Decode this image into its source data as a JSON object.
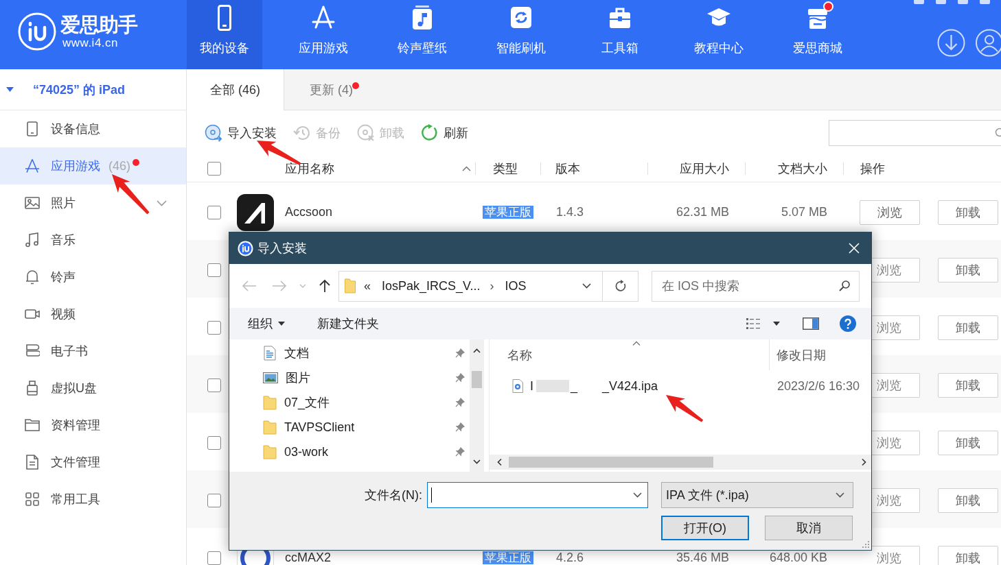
{
  "app": {
    "name": "爱思助手",
    "url": "www.i4.cn"
  },
  "top_nav": [
    {
      "label": "我的设备",
      "selected": true,
      "dot": false
    },
    {
      "label": "应用游戏",
      "selected": false,
      "dot": false
    },
    {
      "label": "铃声壁纸",
      "selected": false,
      "dot": false
    },
    {
      "label": "智能刷机",
      "selected": false,
      "dot": false
    },
    {
      "label": "工具箱",
      "selected": false,
      "dot": false
    },
    {
      "label": "教程中心",
      "selected": false,
      "dot": false
    },
    {
      "label": "爱思商城",
      "selected": false,
      "dot": true
    }
  ],
  "sidebar": {
    "device": {
      "name": "“74025” 的 iPad",
      "expanded": true
    },
    "items": [
      {
        "label": "设备信息",
        "selected": false,
        "dot": false
      },
      {
        "label": "应用游戏",
        "selected": true,
        "count": "(46)",
        "dot": true
      },
      {
        "label": "照片",
        "selected": false,
        "dot": false,
        "expanded": false
      },
      {
        "label": "音乐",
        "selected": false,
        "dot": false
      },
      {
        "label": "铃声",
        "selected": false,
        "dot": false
      },
      {
        "label": "视频",
        "selected": false,
        "dot": false
      },
      {
        "label": "电子书",
        "selected": false,
        "dot": false
      },
      {
        "label": "虚拟U盘",
        "selected": false,
        "dot": false
      },
      {
        "label": "资料管理",
        "selected": false,
        "dot": false
      },
      {
        "label": "文件管理",
        "selected": false,
        "dot": false
      },
      {
        "label": "常用工具",
        "selected": false,
        "dot": false
      }
    ]
  },
  "tabs": [
    {
      "label": "全部 (46)",
      "selected": true,
      "dot": false
    },
    {
      "label": "更新 (4)",
      "selected": false,
      "dot": true
    }
  ],
  "toolbar": {
    "actions": [
      {
        "label": "导入安装",
        "disabled": false
      },
      {
        "label": "备份",
        "disabled": true
      },
      {
        "label": "卸载",
        "disabled": true
      },
      {
        "label": "刷新",
        "disabled": false
      }
    ]
  },
  "table": {
    "select_all": {
      "checked": false
    },
    "columns": [
      {
        "label": "应用名称",
        "sorted": true
      },
      {
        "label": "类型",
        "sorted": false
      },
      {
        "label": "版本",
        "sorted": false
      },
      {
        "label": "应用大小",
        "sorted": false
      },
      {
        "label": "文档大小",
        "sorted": false
      },
      {
        "label": "操作",
        "sorted": false
      }
    ],
    "rows": [
      {
        "checked": false,
        "name": "Accsoon",
        "type": "苹果正版",
        "version": "1.4.3",
        "app_size": "62.31 MB",
        "doc_size": "5.07 MB",
        "actions": [
          "浏览",
          "卸载"
        ]
      },
      {
        "checked": false,
        "actions": [
          "浏览",
          "卸载"
        ]
      },
      {
        "checked": false,
        "actions": [
          "浏览",
          "卸载"
        ]
      },
      {
        "checked": false,
        "actions": [
          "浏览",
          "卸载"
        ]
      },
      {
        "checked": false,
        "actions": [
          "浏览",
          "卸载"
        ]
      },
      {
        "checked": false,
        "actions": [
          "浏览",
          "卸载"
        ]
      },
      {
        "checked": false,
        "name": "ccMAX2",
        "type": "苹果正版",
        "version": "4.2.6",
        "app_size": "35.46 MB",
        "doc_size": "648.00 KB",
        "actions": [
          "浏览",
          "卸载"
        ]
      }
    ]
  },
  "dialog": {
    "title": "导入安装",
    "address": {
      "overflow": "«",
      "path": [
        "IosPak_IRCS_V...",
        "IOS"
      ],
      "separator": "›"
    },
    "search": {
      "placeholder": "在 IOS 中搜索"
    },
    "commands": {
      "organize": "组织",
      "new_folder": "新建文件夹"
    },
    "nav_pane": [
      {
        "label": "文档",
        "kind": "document",
        "pinned": true
      },
      {
        "label": "图片",
        "kind": "picture",
        "pinned": true
      },
      {
        "label": "07_文件",
        "kind": "folder",
        "pinned": true
      },
      {
        "label": "TAVPSClient",
        "kind": "folder",
        "pinned": true
      },
      {
        "label": "03-work",
        "kind": "folder",
        "pinned": true
      }
    ],
    "file_list": {
      "columns": [
        {
          "label": "名称",
          "sorted": true
        },
        {
          "label": "修改日期",
          "sorted": false
        }
      ],
      "files": [
        {
          "name_parts": [
            "I",
            "_",
            "_V424.ipa"
          ],
          "modified": "2023/2/6 16:30"
        }
      ]
    },
    "filename": {
      "label": "文件名(N):"
    },
    "filter": "IPA 文件 (*.ipa)",
    "buttons": [
      {
        "label": "打开(O)",
        "default": true
      },
      {
        "label": "取消",
        "default": false
      }
    ]
  }
}
